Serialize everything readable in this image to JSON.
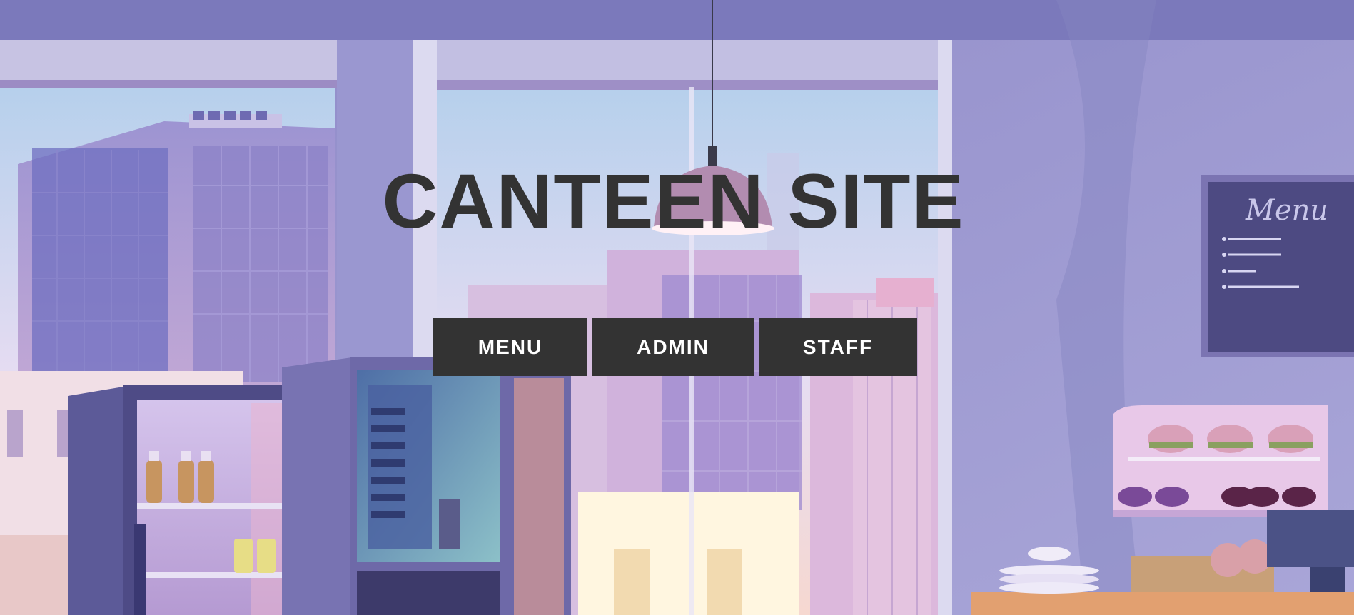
{
  "site": {
    "title": "CANTEEN SITE"
  },
  "nav": {
    "buttons": [
      {
        "label": "MENU"
      },
      {
        "label": "ADMIN"
      },
      {
        "label": "STAFF"
      }
    ]
  },
  "background": {
    "chalkboard_text": "Menu"
  },
  "colors": {
    "title": "#333333",
    "button_bg": "#333333",
    "button_text": "#ffffff",
    "wall": "#8f8cc8",
    "sky": "#b9d3ec"
  }
}
